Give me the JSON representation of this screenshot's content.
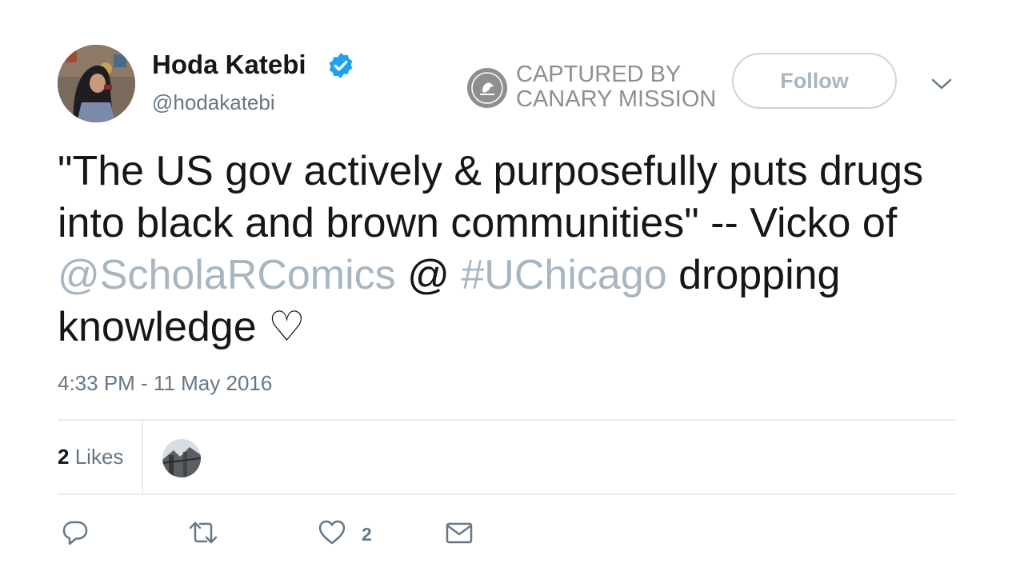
{
  "tweet": {
    "display_name": "Hoda Katebi",
    "handle": "@hodakatebi",
    "verified_icon": "verified-badge-icon",
    "follow_label": "Follow",
    "text_part1": "\"The US gov actively & purposefully puts drugs into black and brown communities\" -- Vicko of ",
    "mention": "@ScholaRComics",
    "text_part2": " @ ",
    "hashtag": "#UChicago",
    "text_part3": " dropping knowledge ♡",
    "timestamp": "4:33 PM - 11 May 2016",
    "likes_count": "2",
    "likes_label": "Likes",
    "action_like_count": "2"
  },
  "overlay": {
    "stamp_text": "CAPTURED BY\nCANARY MISSION",
    "stamp_icon": "canary-bird-icon"
  },
  "colors": {
    "link": "#a8b6c2",
    "muted": "#657786",
    "verified": "#1da1f2",
    "text": "#14171a"
  }
}
